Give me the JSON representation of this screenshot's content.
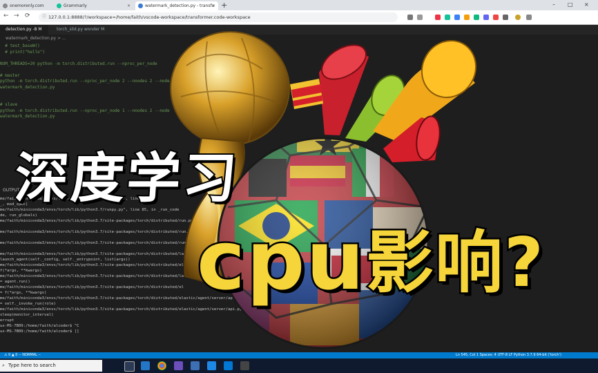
{
  "browser": {
    "tabs": [
      {
        "label": "onemorenly.com",
        "favicon_color": "#888888"
      },
      {
        "label": "Grammarly",
        "favicon_color": "#15c39a"
      },
      {
        "label": "watermark_detection.py - transfo",
        "favicon_color": "#3a7bd5"
      }
    ],
    "new_tab_symbol": "+",
    "window_controls": [
      "–",
      "□",
      "×"
    ],
    "url": "127.0.0.1:8888/?/workspace=/home/faith/vscode-workspace/transformer.code-workspace",
    "nav": [
      "←",
      "→",
      "⟳"
    ]
  },
  "editor": {
    "tabs": [
      {
        "label": "detection.py -8 M",
        "active": true
      },
      {
        "label": "torch_slid.py  wonder M",
        "active": false
      }
    ],
    "breadcrumb": "watermark_detection.py > ...",
    "code_lines": [
      {
        "text": "  # test_baseW()",
        "kind": "comment"
      },
      {
        "text": "  # print(\"hello\")",
        "kind": "comment"
      },
      {
        "text": "",
        "kind": "text"
      },
      {
        "text": "NUM_THREADS=20 python -m torch.distributed.run --nproc_per_node",
        "kind": "comment"
      },
      {
        "text": "",
        "kind": "text"
      },
      {
        "text": "# master",
        "kind": "comment"
      },
      {
        "text": "python -m torch.distributed.run --nproc_per_node 2 --nnodes 2 --node",
        "kind": "comment"
      },
      {
        "text": "watermark_detection.py",
        "kind": "comment"
      },
      {
        "text": "",
        "kind": "text"
      },
      {
        "text": "",
        "kind": "text"
      },
      {
        "text": "# slave",
        "kind": "comment"
      },
      {
        "text": "python -m torch.distributed.run --nproc_per_node 1 --nnodes 2 --node                 master_port 1234",
        "kind": "comment"
      },
      {
        "text": "watermark_detection.py",
        "kind": "comment"
      }
    ]
  },
  "panel": {
    "header": "OUTPUT"
  },
  "terminal": {
    "lines": [
      "                                                                          ",
      "                                                                          ",
      "me/faith/miniconda3/envs/torch/lib/python3.7/runpy.py\", line",
      "_, mod_spec)",
      "me/faith/miniconda3/envs/torch/lib/python3.7/runpy.py\", line 85, in _run_code",
      "de, run_globals)",
      "me/faith/miniconda3/envs/torch/lib/python3.7/site-packages/torch/distributed/run.py",
      "",
      "me/faith/miniconda3/envs/torch/lib/python3.7/site-packages/torch/distributed/run.py",
      "",
      "me/faith/miniconda3/envs/torch/lib/python3.7/site-packages/torch/distributed/run.py",
      "",
      "me/faith/miniconda3/envs/torch/lib/python3.7/site-packages/torch/distributed/la",
      "launch_agent(self._config, self._entrypoint, list(args))",
      "me/faith/miniconda3/envs/torch/lib/python3.7/site-packages/torch/distributed/el",
      "f(*args, **kwargs)",
      "me/faith/miniconda3/envs/torch/lib/python3.7/site-packages/torch/distributed/la",
      "= agent.run()",
      "me/faith/miniconda3/envs/torch/lib/python3.7/site-packages/torch/distributed/el",
      "= f(*args, **kwargs)",
      "me/faith/miniconda3/envs/torch/lib/python3.7/site-packages/torch/distributed/elastic/agent/server/api.py\",",
      "= self._invoke_run(role)",
      "me/faith/miniconda3/envs/torch/lib/python3.7/site-packages/torch/distributed/elastic/agent/server/api.py\", line",
      "sleep(monitor_interval)",
      "errupt",
      "ux-MS-7B09:/home/faith/alcoder$ ^C",
      "ux-MS-7B09:/home/faith/alcoder$ []"
    ]
  },
  "statusbar": {
    "left": "⚠ 0  ▲ 0   -- NORMAL --",
    "right": "Ln 545, Col 1   Spaces: 4   UTF-8   LF   Python   3.7.9 64-bit ('torch')"
  },
  "taskbar": {
    "search_placeholder": "Type here to search",
    "time": "",
    "icons": [
      "task-view-icon",
      "vscode-icon",
      "chrome-icon",
      "app-icon",
      "folder-icon",
      "mail-icon",
      "store-icon",
      "terminal-icon"
    ]
  },
  "overlay": {
    "title_line1": "深度学习",
    "title_line2_latin": "cpu",
    "title_line2_cjk": "影响?",
    "line1_color": "#ffffff",
    "line2_color": "#f6d53a",
    "outline_color": "#000000"
  }
}
